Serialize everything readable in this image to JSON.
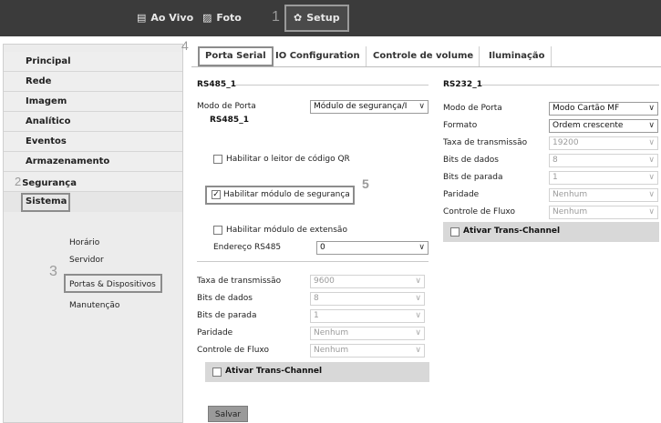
{
  "topnav": {
    "live_label": "Ao Vivo",
    "photo_label": "Foto",
    "setup_label": "Setup",
    "step1": "1"
  },
  "sidebar": {
    "step2": "2",
    "step3": "3",
    "step4": "4",
    "items": [
      "Principal",
      "Rede",
      "Imagem",
      "Analítico",
      "Eventos",
      "Armazenamento",
      "Segurança",
      "Sistema"
    ],
    "sub_items": [
      "Horário",
      "Servidor",
      "Portas & Dispositivos",
      "Manutenção"
    ]
  },
  "tabs": [
    "Porta Serial",
    "IO Configuration",
    "Controle de volume",
    "Iluminação"
  ],
  "rs485": {
    "title": "RS485_1",
    "inner_title": "RS485_1",
    "port_mode_label": "Modo de Porta",
    "port_mode_value": "Módulo de segurança/I",
    "qr_label": "Habilitar o leitor de código QR",
    "security_label": "Habilitar módulo de segurança",
    "step5": "5",
    "extension_label": "Habilitar módulo de extensão",
    "address_label": "Endereço RS485",
    "address_value": "0",
    "baud_label": "Taxa de transmissão",
    "baud_value": "9600",
    "databits_label": "Bits de dados",
    "databits_value": "8",
    "stopbits_label": "Bits de parada",
    "stopbits_value": "1",
    "parity_label": "Paridade",
    "parity_value": "Nenhum",
    "flow_label": "Controle de Fluxo",
    "flow_value": "Nenhum",
    "trans_label": "Ativar Trans-Channel"
  },
  "rs232": {
    "title": "RS232_1",
    "port_mode_label": "Modo de Porta",
    "port_mode_value": "Modo Cartão MF",
    "format_label": "Formato",
    "format_value": "Ordem crescente",
    "baud_label": "Taxa de transmissão",
    "baud_value": "19200",
    "databits_label": "Bits de dados",
    "databits_value": "8",
    "stopbits_label": "Bits de parada",
    "stopbits_value": "1",
    "parity_label": "Paridade",
    "parity_value": "Nenhum",
    "flow_label": "Controle de Fluxo",
    "flow_value": "Nenhum",
    "trans_label": "Ativar Trans-Channel"
  },
  "save_label": "Salvar"
}
